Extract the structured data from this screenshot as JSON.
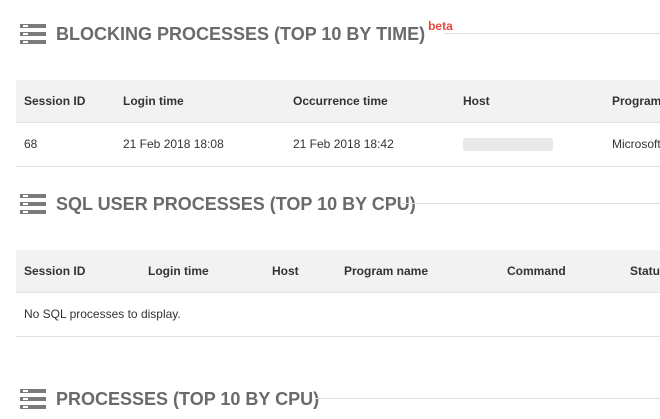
{
  "blocking": {
    "title": "BLOCKING PROCESSES (TOP 10 BY TIME)",
    "badge": "beta",
    "columns": [
      "Session ID",
      "Login time",
      "Occurrence time",
      "Host",
      "Program"
    ],
    "rows": [
      {
        "session_id": "68",
        "login_time": "21 Feb 2018 18:08",
        "occurrence_time": "21 Feb 2018 18:42",
        "program": "Microsoft"
      }
    ]
  },
  "sql_user": {
    "title": "SQL USER PROCESSES (TOP 10 BY CPU)",
    "columns": [
      "Session ID",
      "Login time",
      "Host",
      "Program name",
      "Command",
      "Status"
    ],
    "empty_message": "No SQL processes to display."
  },
  "processes": {
    "title": "PROCESSES (TOP 10 BY CPU)"
  },
  "colors": {
    "heading": "#6a6a6a",
    "badge": "#e8483f",
    "table_header_bg": "#f2f2f2",
    "border": "#e2e2e2",
    "icon": "#7b7b7b"
  },
  "icons": {
    "section_icon": "stack-icon"
  }
}
